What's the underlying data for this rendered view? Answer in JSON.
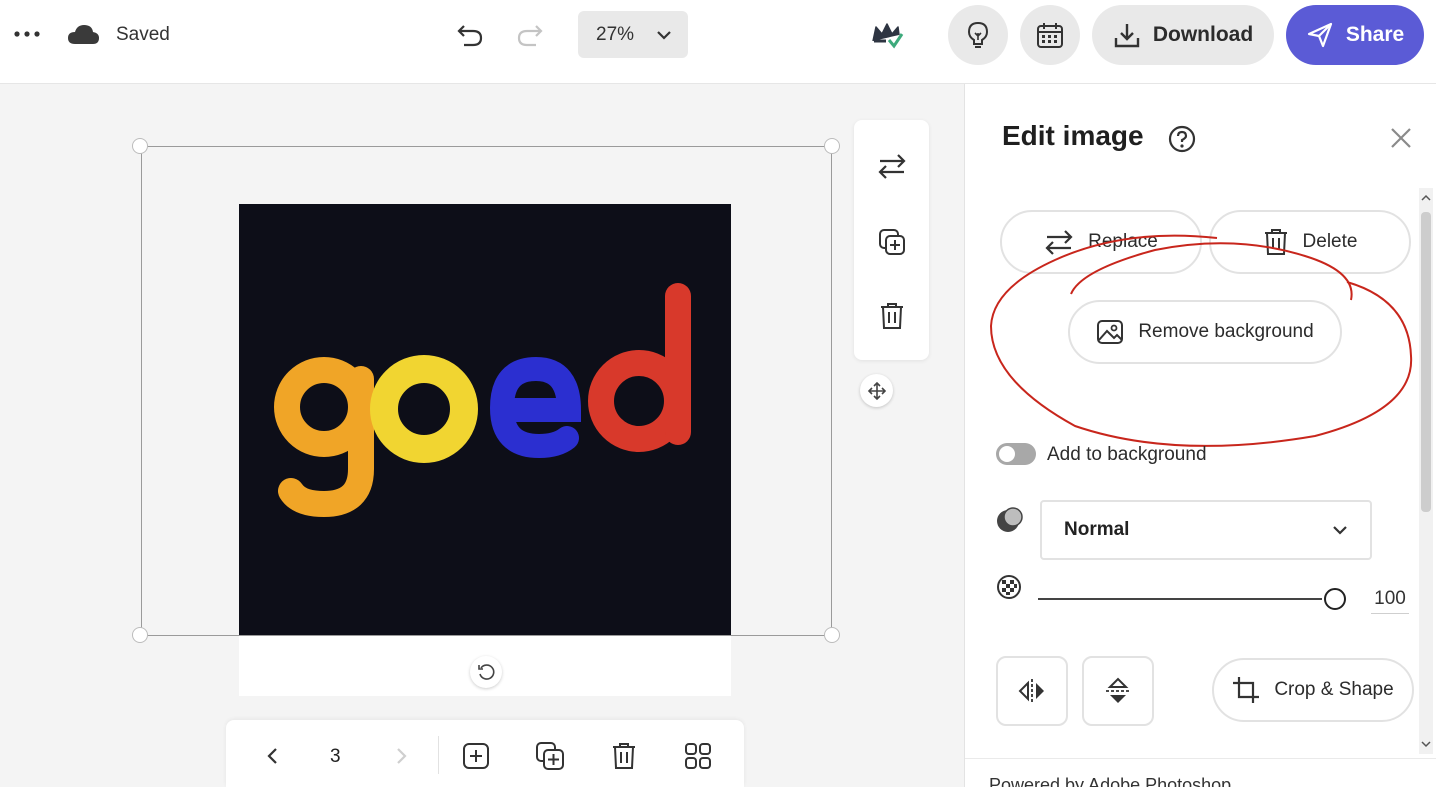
{
  "topbar": {
    "status": "Saved",
    "zoom": "27%",
    "download_label": "Download",
    "share_label": "Share",
    "colors": {
      "share_bg": "#5b5bd6",
      "pill_bg": "#e9e9e9"
    }
  },
  "canvas": {
    "image_text": "goed",
    "letter_colors": [
      "#f0a527",
      "#f1d531",
      "#2b2fd0",
      "#d8392b"
    ]
  },
  "page_nav": {
    "current_page": "3"
  },
  "panel": {
    "title": "Edit image",
    "replace_label": "Replace",
    "delete_label": "Delete",
    "remove_bg_label": "Remove background",
    "add_to_bg_label": "Add to background",
    "blend_mode": "Normal",
    "opacity_value": "100",
    "opacity": 1.0,
    "crop_label": "Crop & Shape",
    "footer": "Powered by Adobe Photoshop",
    "annotation_color": "#c8261c"
  }
}
